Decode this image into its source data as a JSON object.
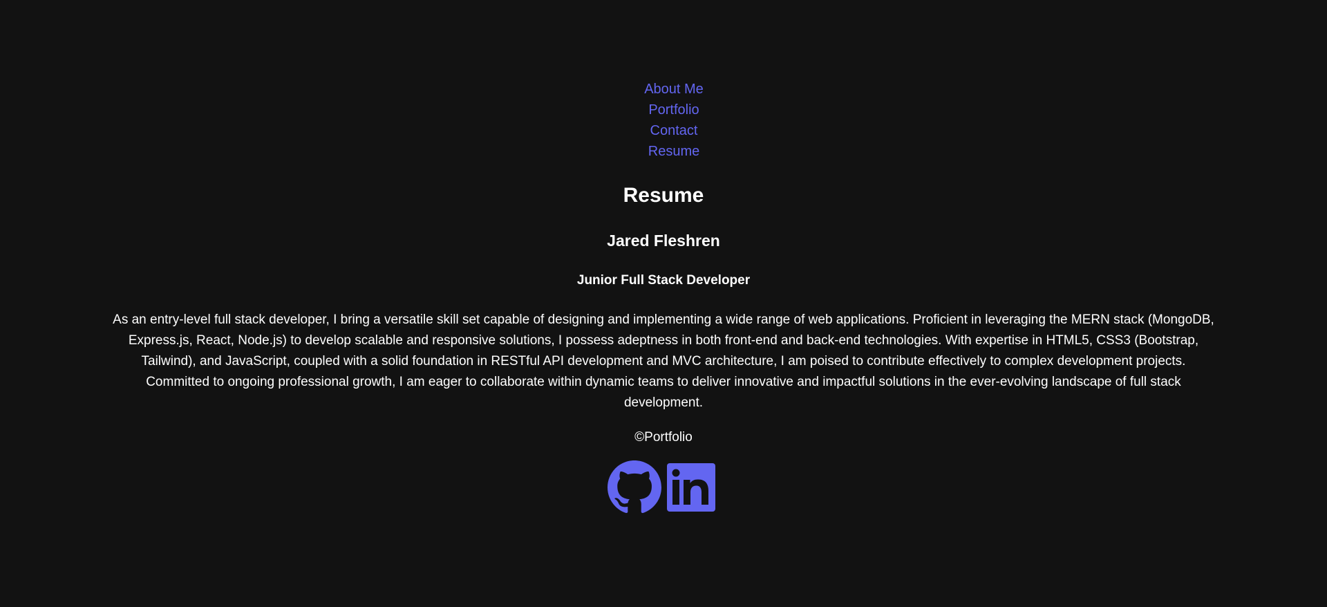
{
  "nav": {
    "items": [
      {
        "label": "About Me"
      },
      {
        "label": "Portfolio"
      },
      {
        "label": "Contact"
      },
      {
        "label": "Resume"
      }
    ]
  },
  "page": {
    "heading": "Resume"
  },
  "resume": {
    "name": "Jared Fleshren",
    "title": "Junior Full Stack Developer",
    "summary": "As an entry-level full stack developer, I bring a versatile skill set capable of designing and implementing a wide range of web applications. Proficient in leveraging the MERN stack (MongoDB, Express.js, React, Node.js) to develop scalable and responsive solutions, I possess adeptness in both front-end and back-end technologies. With expertise in HTML5, CSS3 (Bootstrap, Tailwind), and JavaScript, coupled with a solid foundation in RESTful API development and MVC architecture, I am poised to contribute effectively to complex development projects. Committed to ongoing professional growth, I am eager to collaborate within dynamic teams to deliver innovative and impactful solutions in the ever-evolving landscape of full stack development."
  },
  "footer": {
    "copyright": "©Portfolio",
    "socials": [
      {
        "icon": "github-icon"
      },
      {
        "icon": "linkedin-icon"
      }
    ]
  },
  "colors": {
    "background": "#121212",
    "accent": "#6366f1",
    "text": "#ffffff"
  }
}
